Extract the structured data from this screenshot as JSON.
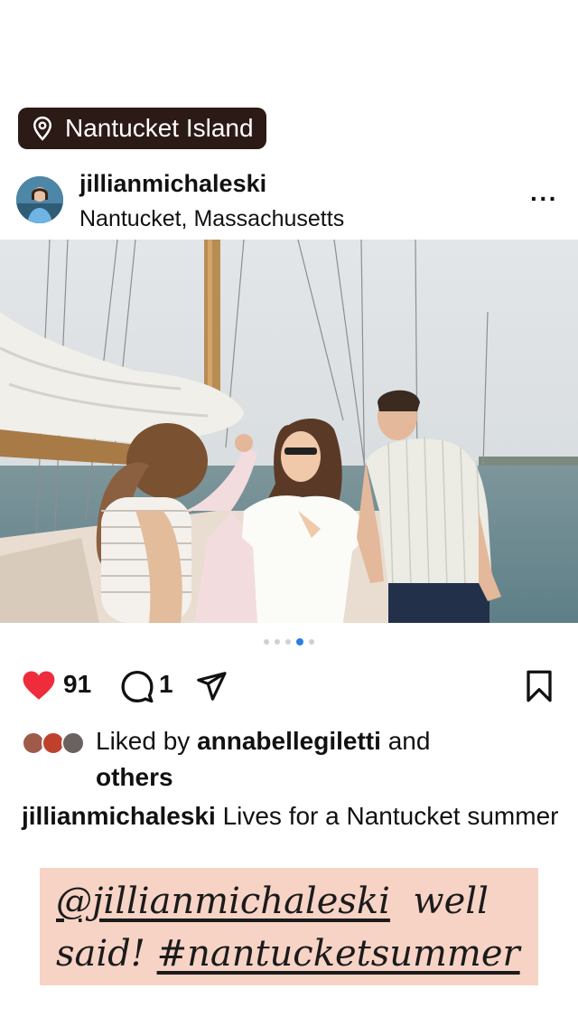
{
  "location_sticker": {
    "label": "Nantucket Island",
    "icon": "map-pin-icon"
  },
  "post": {
    "username": "jillianmichaleski",
    "location": "Nantucket, Massachusetts",
    "more_label": "···",
    "carousel": {
      "count": 5,
      "active_index": 3
    },
    "likes": "91",
    "comments": "1",
    "liked_by": {
      "prefix": "Liked by",
      "user": "annabellegiletti",
      "suffix": "and",
      "others": "others"
    },
    "caption": {
      "user": "jillianmichaleski",
      "text": "Lives for a Nantucket summer"
    }
  },
  "comment_sticker": {
    "mention": "@jillianmichaleski",
    "text1": "well",
    "text2": "said!",
    "hashtag": "#nantucketsummer"
  },
  "colors": {
    "like": "#ee2c3c",
    "sticker_bg": "#2c1a16",
    "comment_bg": "#f7d3c6",
    "active_dot": "#2b7fe6"
  }
}
